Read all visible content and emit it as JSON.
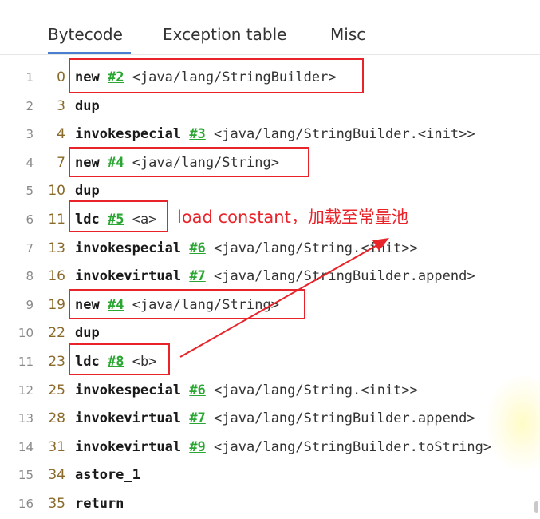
{
  "tabs": [
    {
      "label": "Bytecode",
      "active": true
    },
    {
      "label": "Exception table",
      "active": false
    },
    {
      "label": "Misc",
      "active": false
    }
  ],
  "colors": {
    "accent": "#4a7fd0",
    "reference": "#2aa632",
    "annotation": "#e8242a"
  },
  "lines": [
    {
      "n": "1",
      "offset": "0",
      "op": "new",
      "ref": "#2",
      "arg": "<java/lang/StringBuilder>"
    },
    {
      "n": "2",
      "offset": "3",
      "op": "dup",
      "ref": "",
      "arg": ""
    },
    {
      "n": "3",
      "offset": "4",
      "op": "invokespecial",
      "ref": "#3",
      "arg": "<java/lang/StringBuilder.<init>>"
    },
    {
      "n": "4",
      "offset": "7",
      "op": "new",
      "ref": "#4",
      "arg": "<java/lang/String>"
    },
    {
      "n": "5",
      "offset": "10",
      "op": "dup",
      "ref": "",
      "arg": ""
    },
    {
      "n": "6",
      "offset": "11",
      "op": "ldc",
      "ref": "#5",
      "arg": "<a>"
    },
    {
      "n": "7",
      "offset": "13",
      "op": "invokespecial",
      "ref": "#6",
      "arg": "<java/lang/String.<init>>"
    },
    {
      "n": "8",
      "offset": "16",
      "op": "invokevirtual",
      "ref": "#7",
      "arg": "<java/lang/StringBuilder.append>"
    },
    {
      "n": "9",
      "offset": "19",
      "op": "new",
      "ref": "#4",
      "arg": "<java/lang/String>"
    },
    {
      "n": "10",
      "offset": "22",
      "op": "dup",
      "ref": "",
      "arg": ""
    },
    {
      "n": "11",
      "offset": "23",
      "op": "ldc",
      "ref": "#8",
      "arg": "<b>"
    },
    {
      "n": "12",
      "offset": "25",
      "op": "invokespecial",
      "ref": "#6",
      "arg": "<java/lang/String.<init>>"
    },
    {
      "n": "13",
      "offset": "28",
      "op": "invokevirtual",
      "ref": "#7",
      "arg": "<java/lang/StringBuilder.append>"
    },
    {
      "n": "14",
      "offset": "31",
      "op": "invokevirtual",
      "ref": "#9",
      "arg": "<java/lang/StringBuilder.toString>"
    },
    {
      "n": "15",
      "offset": "34",
      "op": "astore_1",
      "ref": "",
      "arg": ""
    },
    {
      "n": "16",
      "offset": "35",
      "op": "return",
      "ref": "",
      "arg": ""
    }
  ],
  "annotation": "load constant，加载至常量池"
}
